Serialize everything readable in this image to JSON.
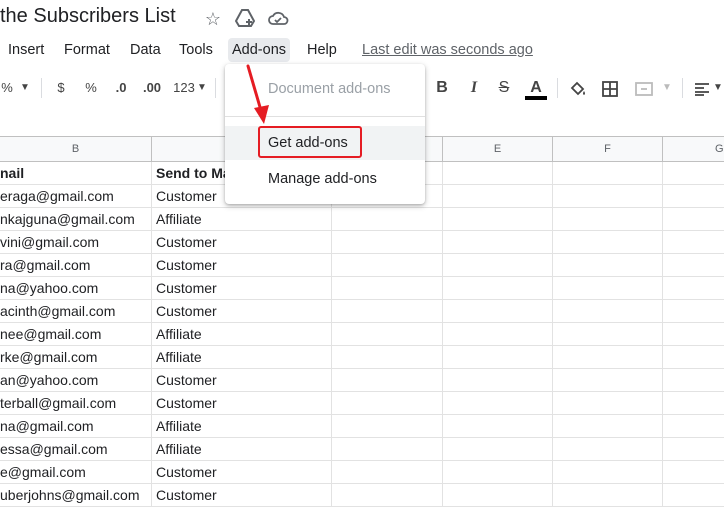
{
  "title": "the Subscribers List",
  "menu": [
    "Insert",
    "Format",
    "Data",
    "Tools",
    "Add-ons",
    "Help"
  ],
  "last_edit": "Last edit was seconds ago",
  "toolbar": {
    "percent_left": "%",
    "currency": "$",
    "percent": "%",
    "decrease_decimal": ".0",
    "increase_decimal": ".00",
    "more_formats": "123",
    "bold": "B",
    "italic": "I",
    "strikethrough": "S",
    "text_color": "A"
  },
  "columns": [
    "B",
    "E",
    "F",
    "G"
  ],
  "dropdown": {
    "document_addons": "Document add-ons",
    "get_addons": "Get add-ons",
    "manage_addons": "Manage add-ons"
  },
  "table": {
    "headers": [
      "nail",
      "Send to Ma"
    ],
    "rows": [
      [
        "eraga@gmail.com",
        "Customer"
      ],
      [
        "nkajguna@gmail.com",
        "Affiliate"
      ],
      [
        "vini@gmail.com",
        "Customer"
      ],
      [
        "ra@gmail.com",
        "Customer"
      ],
      [
        "na@yahoo.com",
        "Customer"
      ],
      [
        "acinth@gmail.com",
        "Customer"
      ],
      [
        "nee@gmail.com",
        "Affiliate"
      ],
      [
        "rke@gmail.com",
        "Affiliate"
      ],
      [
        "an@yahoo.com",
        "Customer"
      ],
      [
        "terball@gmail.com",
        "Customer"
      ],
      [
        "na@gmail.com",
        "Affiliate"
      ],
      [
        "essa@gmail.com",
        "Affiliate"
      ],
      [
        "e@gmail.com",
        "Customer"
      ],
      [
        "uberjohns@gmail.com",
        "Customer"
      ]
    ]
  },
  "colors": {
    "highlight": "#e51c23",
    "menu_active": "#e8eaed",
    "icon": "#5f6368"
  }
}
